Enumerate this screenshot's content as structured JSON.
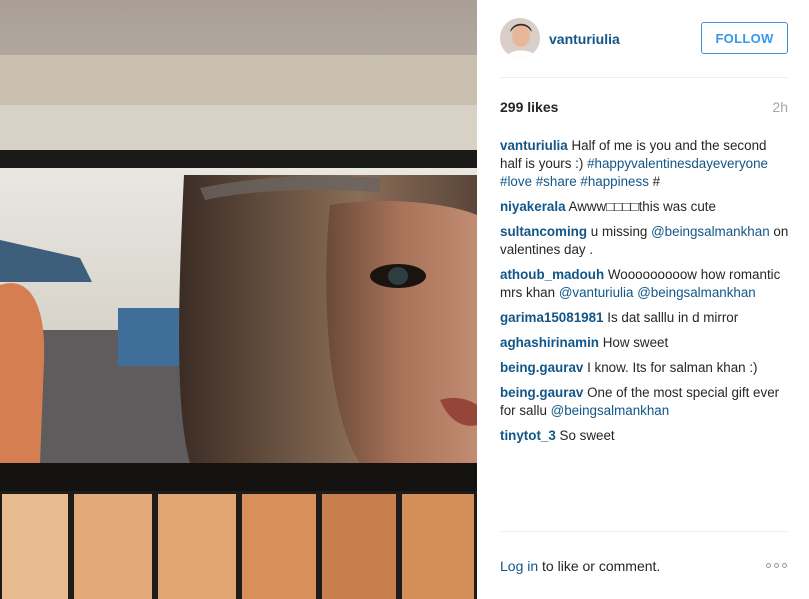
{
  "post": {
    "photo_icon": "mirror-selfie-photo",
    "username": "vanturiulia",
    "follow_label": "FOLLOW",
    "likes": "299 likes",
    "time": "2h",
    "caption": {
      "username": "vanturiulia",
      "text": "Half of me is you and the second half is yours :)",
      "tags": "#happyvalentinesdayeveryone #love #share #happiness",
      "trailing": "#"
    },
    "comments": [
      {
        "username": "niyakerala",
        "before": "Awww",
        "emoji": "□□□□",
        "text": "this was cute"
      },
      {
        "username": "sultancoming",
        "text": "u missing",
        "mention": "@beingsalmankhan",
        "after": "on valentines day ."
      },
      {
        "username": "athoub_madouh",
        "text": "Wooooooooow how romantic mrs khan",
        "mention": "@vanturiulia",
        "mention2": "@beingsalmankhan"
      },
      {
        "username": "garima15081981",
        "text": "Is dat salllu in d mirror"
      },
      {
        "username": "aghashirinamin",
        "text": "How sweet"
      },
      {
        "username": "being.gaurav",
        "text": "I know. Its for salman khan :)"
      },
      {
        "username": "being.gaurav",
        "text": "One of the most special gift ever for sallu",
        "mention": "@beingsalmankhan"
      },
      {
        "username": "tinytot_3",
        "text": "So sweet"
      }
    ],
    "login_label": "Log in",
    "login_suffix": "to like or comment."
  }
}
